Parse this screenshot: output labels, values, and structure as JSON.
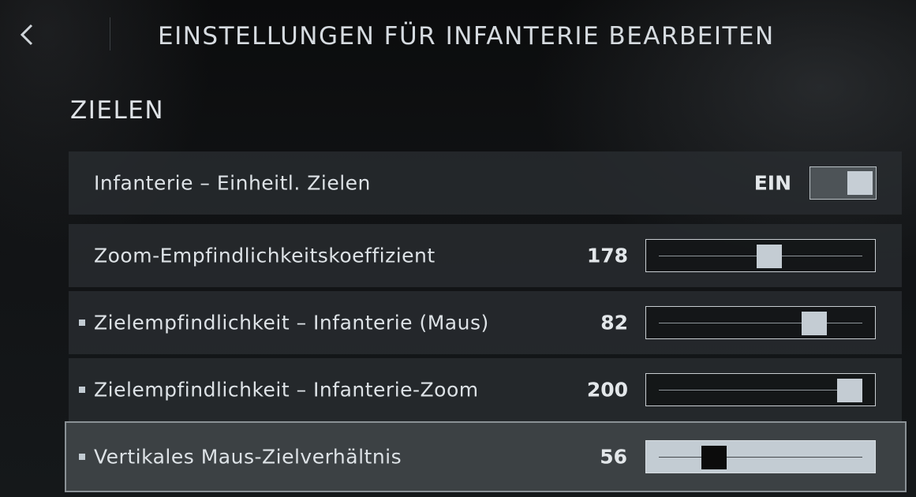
{
  "header": {
    "back_icon": "chevron-left-icon",
    "title": "EINSTELLUNGEN FÜR INFANTERIE BEARBEITEN"
  },
  "section": {
    "title": "ZIELEN"
  },
  "settings": [
    {
      "label": "Infanterie – Einheitl. Zielen",
      "type": "toggle",
      "value": "EIN",
      "on": true,
      "bullet": false,
      "selected": false
    },
    {
      "label": "Zoom-Empfindlichkeitskoeffizient",
      "type": "slider",
      "value": "178",
      "fill_fraction": 0.55,
      "bullet": false,
      "selected": false
    },
    {
      "label": "Zielempfindlichkeit – Infanterie (Maus)",
      "type": "slider",
      "value": "82",
      "fill_fraction": 0.8,
      "bullet": true,
      "selected": false
    },
    {
      "label": "Zielempfindlichkeit – Infanterie-Zoom",
      "type": "slider",
      "value": "200",
      "fill_fraction": 1.0,
      "bullet": true,
      "selected": false
    },
    {
      "label": "Vertikales Maus-Zielverhältnis",
      "type": "slider",
      "value": "56",
      "fill_fraction": 0.24,
      "bullet": true,
      "selected": true
    }
  ],
  "colors": {
    "accent": "#c4ccd3",
    "row_bg": "#282c2f",
    "selected_row_bg": "#3c4144"
  }
}
